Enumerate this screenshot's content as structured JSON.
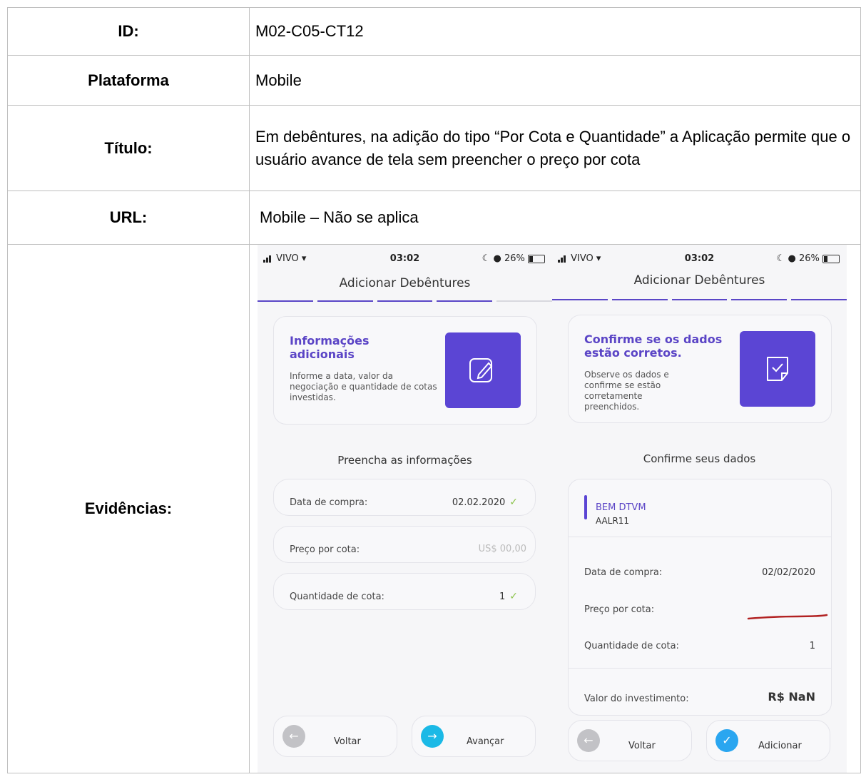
{
  "rows": {
    "id": {
      "label": "ID:",
      "value": "M02-C05-CT12"
    },
    "plataforma": {
      "label": "Plataforma",
      "value": "Mobile"
    },
    "titulo": {
      "label": "Título:",
      "value": "Em debêntures, na adição do tipo “Por Cota e Quantidade” a Aplicação permite que o usuário avance de tela sem preencher o preço por cota"
    },
    "url": {
      "label": "URL:",
      "value": "Mobile – Não se aplica"
    },
    "evidencias": {
      "label": "Evidências:"
    }
  },
  "screens": {
    "status": {
      "carrier": "VIVO",
      "time": "03:02",
      "battery": "26%"
    },
    "left": {
      "title": "Adicionar Debêntures",
      "card_title": "Informações adicionais",
      "card_desc": "Informe a data, valor da negociação e quantidade de cotas investidas.",
      "card_icon": "edit-icon",
      "section": "Preencha as informações",
      "fields": [
        {
          "label": "Data de compra:",
          "value": "02.02.2020"
        },
        {
          "label": "Preço por cota:",
          "placeholder": "US$ 00,00"
        },
        {
          "label": "Quantidade de cota:",
          "value": "1"
        }
      ],
      "back": "Voltar",
      "next": "Avançar"
    },
    "right": {
      "title": "Adicionar Debêntures",
      "card_title": "Confirme se os dados estão corretos.",
      "card_desc": "Observe os dados e confirme se estão corretamente preenchidos.",
      "card_icon": "confirm-icon",
      "section": "Confirme seus dados",
      "broker": "BEM DTVM",
      "ticker": "AALR11",
      "rows": [
        {
          "label": "Data de compra:",
          "value": "02/02/2020"
        },
        {
          "label": "Preço por cota:",
          "value": ""
        },
        {
          "label": "Quantidade de cota:",
          "value": "1"
        }
      ],
      "total_label": "Valor do investimento:",
      "total_value": "R$ NaN",
      "back": "Voltar",
      "add": "Adicionar"
    }
  },
  "colors": {
    "accent": "#5b45d4",
    "check": "#8bc34a",
    "annotation": "#b22222"
  }
}
